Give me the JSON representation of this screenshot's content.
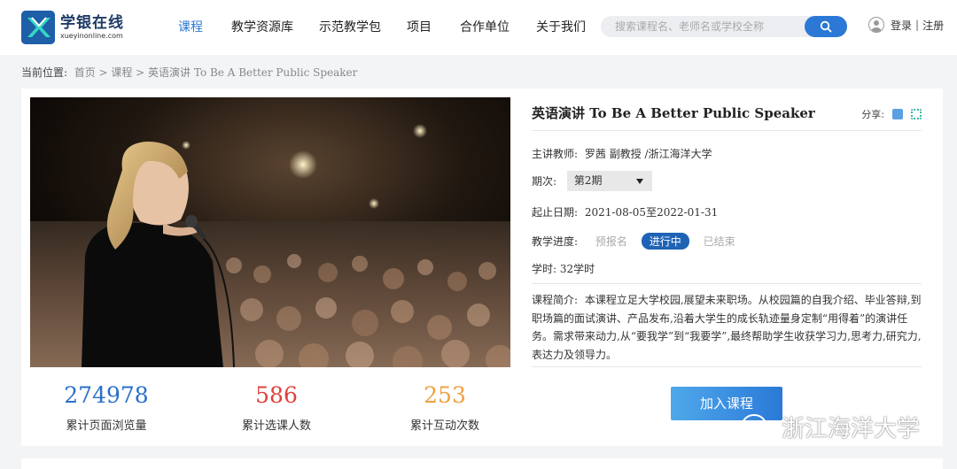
{
  "brand": {
    "name": "学银在线",
    "domain": "xueyinonline.com"
  },
  "nav": {
    "items": [
      "课程",
      "教学资源库",
      "示范教学包",
      "项目",
      "合作单位",
      "关于我们"
    ],
    "active_index": 0
  },
  "search": {
    "placeholder": "搜索课程名、老师名或学校全称"
  },
  "user": {
    "login": "登录",
    "separator": "|",
    "register": "注册"
  },
  "breadcrumb": {
    "lead": "当前位置:",
    "path": "首页 > 课程 > 英语演讲 To Be A Better Public Speaker"
  },
  "course": {
    "title": "英语演讲 To Be A Better Public Speaker",
    "share_label": "分享:",
    "teacher_label": "主讲教师:",
    "teacher": "罗茜 副教授 /浙江海洋大学",
    "term_label": "期次:",
    "term_selected": "第2期",
    "dates_label": "起止日期:",
    "dates": "2021-08-05至2022-01-31",
    "progress_label": "教学进度:",
    "stages": [
      "预报名",
      "进行中",
      "已结束"
    ],
    "active_stage_index": 1,
    "hours_label": "学时:",
    "hours": "32学时",
    "intro_label": "课程简介:",
    "intro": "本课程立足大学校园,展望未来职场。从校园篇的自我介绍、毕业答辩,到职场篇的面试演讲、产品发布,沿着大学生的成长轨迹量身定制“用得着”的演讲任务。需求带来动力,从“要我学”到“我要学”,最终帮助学生收获学习力,思考力,研究力,表达力及领导力。",
    "join_button": "加入课程"
  },
  "stats": [
    {
      "value": "274978",
      "label": "累计页面浏览量",
      "color": "#2a6fc9"
    },
    {
      "value": "586",
      "label": "累计选课人数",
      "color": "#e0413a"
    },
    {
      "value": "253",
      "label": "累计互动次数",
      "color": "#f0a040"
    }
  ],
  "watermark": {
    "text": "浙江海洋大学"
  },
  "colors": {
    "accent": "#2b78d6",
    "active_stage": "#1f63b5"
  }
}
